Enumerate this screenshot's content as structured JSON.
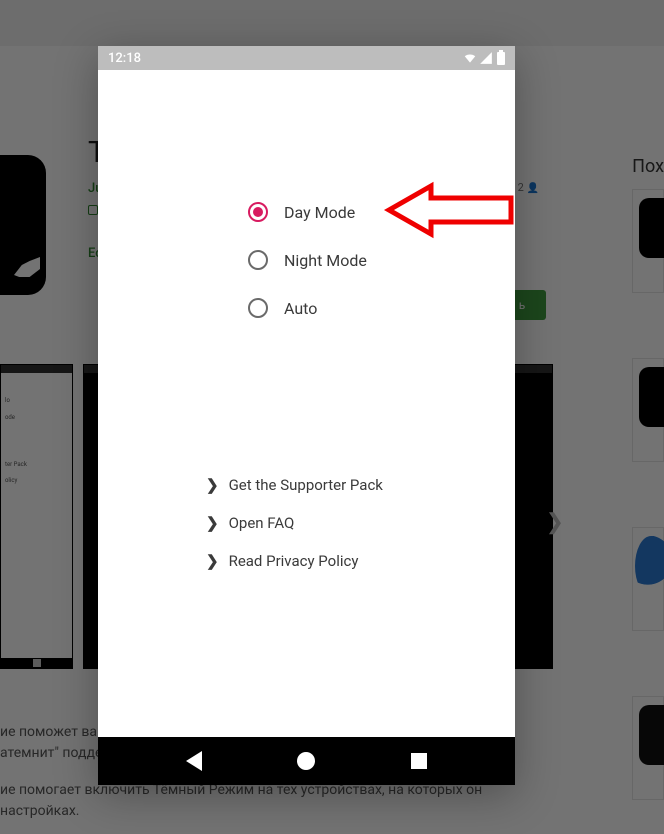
{
  "statusbar": {
    "time": "12:18"
  },
  "modes": {
    "options": [
      {
        "id": "day",
        "label": "Day Mode",
        "selected": true
      },
      {
        "id": "night",
        "label": "Night Mode",
        "selected": false
      },
      {
        "id": "auto",
        "label": "Auto",
        "selected": false
      }
    ]
  },
  "links": {
    "items": [
      {
        "id": "supporter",
        "label": "Get the Supporter Pack"
      },
      {
        "id": "faq",
        "label": "Open FAQ"
      },
      {
        "id": "privacy",
        "label": "Read Privacy Policy"
      }
    ]
  },
  "background": {
    "title_fragment": "T",
    "dev_fragment": "Ju",
    "editors_fragment": "Ec",
    "similar_heading": "Пох",
    "install_label_fragment": "ь",
    "people_fragment": "2",
    "desc1": "ие поможет вам",
    "desc1b": "атемнит\" подде",
    "desc2": "ие помогает включить Тёмный Режим на тех устройствах, на которых он",
    "desc2b": "настройках.",
    "mini": {
      "l1": "lo",
      "l2": "ode",
      "l3": "ter Pack",
      "l4": "olicy"
    }
  }
}
